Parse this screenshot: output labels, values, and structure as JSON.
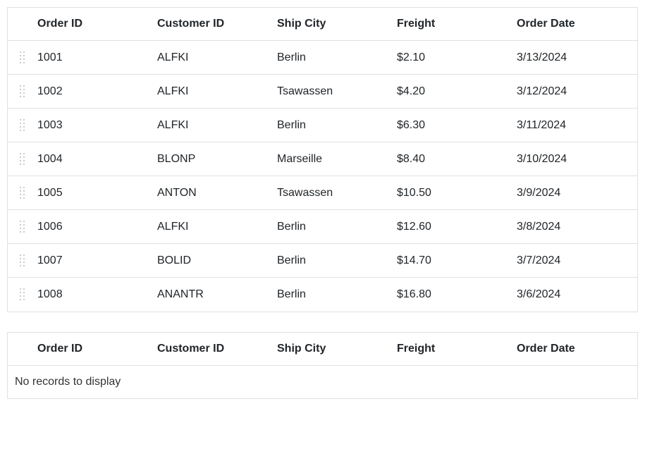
{
  "grid_source": {
    "columns": [
      {
        "key": "orderId",
        "label": "Order ID"
      },
      {
        "key": "customerId",
        "label": "Customer ID"
      },
      {
        "key": "shipCity",
        "label": "Ship City"
      },
      {
        "key": "freight",
        "label": "Freight"
      },
      {
        "key": "orderDate",
        "label": "Order Date"
      }
    ],
    "rows": [
      {
        "orderId": "1001",
        "customerId": "ALFKI",
        "shipCity": "Berlin",
        "freight": "$2.10",
        "orderDate": "3/13/2024"
      },
      {
        "orderId": "1002",
        "customerId": "ALFKI",
        "shipCity": "Tsawassen",
        "freight": "$4.20",
        "orderDate": "3/12/2024"
      },
      {
        "orderId": "1003",
        "customerId": "ALFKI",
        "shipCity": "Berlin",
        "freight": "$6.30",
        "orderDate": "3/11/2024"
      },
      {
        "orderId": "1004",
        "customerId": "BLONP",
        "shipCity": "Marseille",
        "freight": "$8.40",
        "orderDate": "3/10/2024"
      },
      {
        "orderId": "1005",
        "customerId": "ANTON",
        "shipCity": "Tsawassen",
        "freight": "$10.50",
        "orderDate": "3/9/2024"
      },
      {
        "orderId": "1006",
        "customerId": "ALFKI",
        "shipCity": "Berlin",
        "freight": "$12.60",
        "orderDate": "3/8/2024"
      },
      {
        "orderId": "1007",
        "customerId": "BOLID",
        "shipCity": "Berlin",
        "freight": "$14.70",
        "orderDate": "3/7/2024"
      },
      {
        "orderId": "1008",
        "customerId": "ANANTR",
        "shipCity": "Berlin",
        "freight": "$16.80",
        "orderDate": "3/6/2024"
      }
    ]
  },
  "grid_target": {
    "columns": [
      {
        "key": "orderId",
        "label": "Order ID"
      },
      {
        "key": "customerId",
        "label": "Customer ID"
      },
      {
        "key": "shipCity",
        "label": "Ship City"
      },
      {
        "key": "freight",
        "label": "Freight"
      },
      {
        "key": "orderDate",
        "label": "Order Date"
      }
    ],
    "rows": [],
    "emptyText": "No records to display"
  }
}
